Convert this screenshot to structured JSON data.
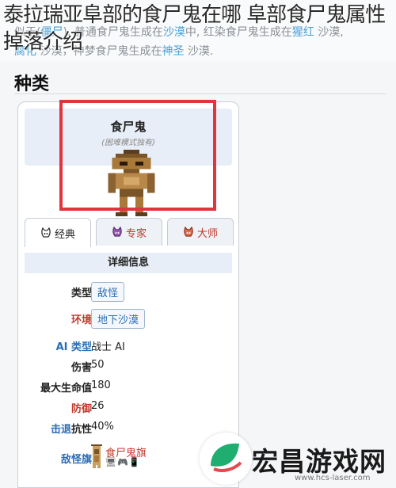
{
  "overlay_title": "泰拉瑞亚阜部的食尸鬼在哪 阜部食尸鬼属性掉落介绍",
  "intro": {
    "line1": [
      {
        "t": "似于(",
        "c": "n"
      },
      {
        "t": "僵尸",
        "c": "h"
      },
      {
        "t": "). 普通食尸鬼生成在",
        "c": "n"
      },
      {
        "t": "沙漠",
        "c": "h"
      },
      {
        "t": "中, 红染食尸鬼生成在",
        "c": "n"
      },
      {
        "t": "猩红",
        "c": "h"
      },
      {
        "t": " 沙漠,",
        "c": "n"
      }
    ],
    "line2": [
      {
        "t": "腐化",
        "c": "h"
      },
      {
        "t": " 沙漠，神梦食尸鬼生成在",
        "c": "n"
      },
      {
        "t": "神圣",
        "c": "h"
      },
      {
        "t": " 沙漠.",
        "c": "n"
      }
    ]
  },
  "section_heading": "种类",
  "infobox": {
    "name": "食尸鬼",
    "subtitle": "(困难模式独有)",
    "tabs": [
      {
        "label": "经典",
        "icon": "classic-mode-icon",
        "active": true
      },
      {
        "label": "专家",
        "icon": "expert-mode-icon",
        "active": false
      },
      {
        "label": "大师",
        "icon": "master-mode-icon",
        "active": false
      }
    ],
    "detail_title": "详细信息",
    "stats": {
      "type_label": "类型",
      "type_value": "敌怪",
      "env_label": "环境",
      "env_value": "地下沙漠",
      "ai_label": "AI 类型",
      "ai_value": "战士 AI",
      "damage_label": "伤害",
      "damage_value": "50",
      "hp_label": "最大生命值",
      "hp_value": "180",
      "defense_label": "防御",
      "defense_value": "26",
      "kb_label_link": "击退",
      "kb_label_rest": "抗性",
      "kb_value": "40%",
      "banner_label": "敌怪旗",
      "banner_value": "食尸鬼旗"
    }
  },
  "watermark": {
    "brand": "宏昌游戏网",
    "url": "www.hcs-laser.com"
  },
  "colors": {
    "accent_link": "#2a6db5",
    "highlight_red": "#e0343e",
    "header_bg": "#e8eef7"
  }
}
